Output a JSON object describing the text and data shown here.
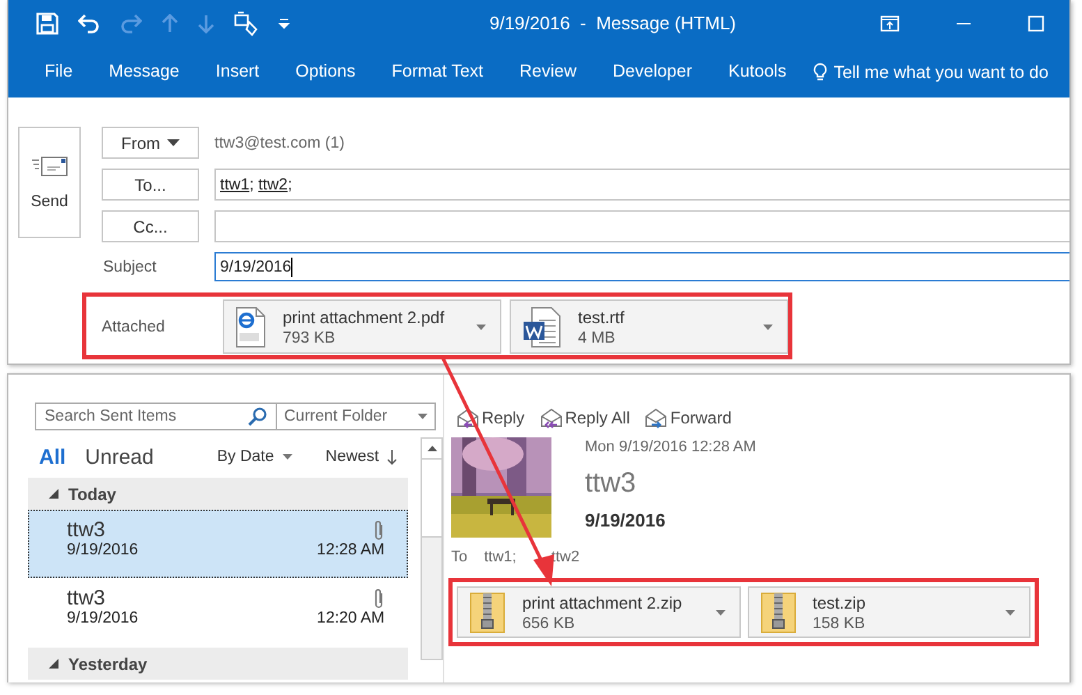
{
  "window": {
    "title": "9/19/2016  -  Message (HTML)"
  },
  "ribbon_tabs": [
    {
      "label": "File"
    },
    {
      "label": "Message"
    },
    {
      "label": "Insert"
    },
    {
      "label": "Options"
    },
    {
      "label": "Format Text"
    },
    {
      "label": "Review"
    },
    {
      "label": "Developer"
    },
    {
      "label": "Kutools"
    }
  ],
  "tell_me": "Tell me what you want to do",
  "compose": {
    "send": "Send",
    "from": {
      "button": "From",
      "value": "ttw3@test.com (1)"
    },
    "to": {
      "button": "To...",
      "recipients": [
        {
          "name": "ttw1",
          "separator": ";"
        },
        {
          "name": "ttw2",
          "separator": ";"
        }
      ]
    },
    "cc": {
      "button": "Cc..."
    },
    "subject": {
      "label": "Subject",
      "value": "9/19/2016"
    },
    "attached_label": "Attached",
    "attachments": [
      {
        "kind": "pdf",
        "name": "print attachment 2.pdf",
        "size": "793 KB"
      },
      {
        "kind": "word",
        "name": "test.rtf",
        "size": "4 MB"
      }
    ]
  },
  "mail_list": {
    "search": {
      "placeholder": "Search Sent Items",
      "scope": "Current Folder"
    },
    "filters": [
      {
        "label": "All",
        "selected": true
      },
      {
        "label": "Unread",
        "selected": false
      }
    ],
    "sort": "By Date",
    "order": "Newest",
    "groups": [
      {
        "label": "Today",
        "expanded": true,
        "messages": [
          {
            "sender": "ttw3",
            "date": "9/19/2016",
            "time": "12:28 AM",
            "has_attachment": true,
            "selected": true
          },
          {
            "sender": "ttw3",
            "date": "9/19/2016",
            "time": "12:20 AM",
            "has_attachment": true,
            "selected": false
          }
        ]
      },
      {
        "label": "Yesterday",
        "expanded": true
      }
    ]
  },
  "reading_pane": {
    "actions": [
      {
        "kind": "reply",
        "label": "Reply"
      },
      {
        "kind": "reply_all",
        "label": "Reply All"
      },
      {
        "kind": "forward",
        "label": "Forward"
      }
    ],
    "sent": "Mon 9/19/2016 12:28 AM",
    "sender": "ttw3",
    "subject": "9/19/2016",
    "to_label": "To",
    "to": "ttw1; ttw2",
    "attachments": [
      {
        "kind": "zip",
        "name": "print attachment 2.zip",
        "size": "656 KB"
      },
      {
        "kind": "zip",
        "name": "test.zip",
        "size": "158 KB"
      }
    ]
  }
}
